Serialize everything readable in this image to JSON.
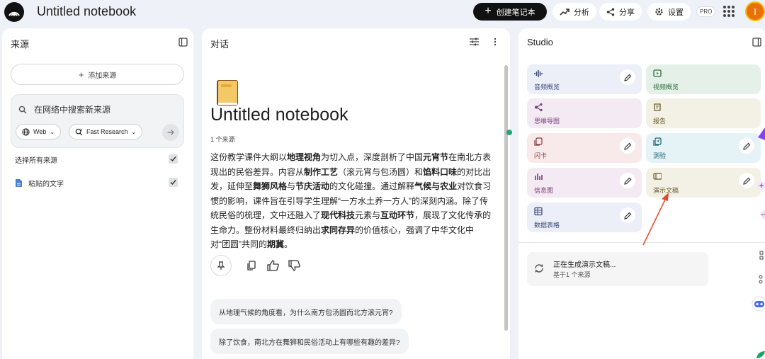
{
  "app": {
    "notebook_title": "Untitled notebook",
    "create_button": "创建笔记本",
    "analytics_button": "分析",
    "share_button": "分享",
    "settings_button": "设置",
    "pro_badge": "PRO",
    "avatar_letter": "I"
  },
  "sources": {
    "header": "来源",
    "add_button": "添加来源",
    "search_placeholder": "在网络中搜索新来源",
    "web_chip": "Web",
    "research_chip": "Fast Research",
    "select_all": "选择所有来源",
    "items": [
      {
        "label": "粘贴的文字",
        "checked": true
      }
    ]
  },
  "chat": {
    "header": "对话",
    "title": "Untitled notebook",
    "source_count": "1 个来源",
    "summary": [
      {
        "t": "这份教学课件大纲以"
      },
      {
        "t": "地理视角",
        "b": true
      },
      {
        "t": "为切入点，深度剖析了中国"
      },
      {
        "t": "元宵节",
        "b": true
      },
      {
        "t": "在南北方表现出的民俗差异。内容从"
      },
      {
        "t": "制作工艺",
        "b": true
      },
      {
        "t": "（滚元宵与包汤圆）和"
      },
      {
        "t": "馅料口味",
        "b": true
      },
      {
        "t": "的对比出发，延伸至"
      },
      {
        "t": "舞狮风格",
        "b": true
      },
      {
        "t": "与"
      },
      {
        "t": "节庆活动",
        "b": true
      },
      {
        "t": "的文化碰撞。通过解释"
      },
      {
        "t": "气候与农业",
        "b": true
      },
      {
        "t": "对饮食习惯的影响，课件旨在引导学生理解“一方水土养一方人”的深刻内涵。除了传统民俗的梳理，文中还融入了"
      },
      {
        "t": "现代科技",
        "b": true
      },
      {
        "t": "元素与"
      },
      {
        "t": "互动环节",
        "b": true
      },
      {
        "t": "，展现了文化传承的生命力。整份材料最终归纳出"
      },
      {
        "t": "求同存异",
        "b": true
      },
      {
        "t": "的价值核心，强调了中华文化中对“团圆”共同的"
      },
      {
        "t": "期冀",
        "b": true
      },
      {
        "t": "。"
      }
    ],
    "suggestions": [
      "从地理气候的角度看，为什么南方包汤圆而北方滚元宵?",
      "除了饮食，南北方在舞狮和民俗活动上有哪些有趣的差异?"
    ]
  },
  "studio": {
    "header": "Studio",
    "cards": [
      {
        "label": "音频概览",
        "bg": "#eceef8",
        "fg": "#3c4a7a",
        "icon": "audio-wave-icon",
        "edit": true
      },
      {
        "label": "视频概览",
        "bg": "#e5f1e8",
        "fg": "#2e6b3e",
        "icon": "video-icon",
        "edit": false
      },
      {
        "label": "思维导图",
        "bg": "#f3eaf3",
        "fg": "#7a3c78",
        "icon": "mind-map-icon",
        "edit": false
      },
      {
        "label": "报告",
        "bg": "#f3f1e6",
        "fg": "#6b5a2a",
        "icon": "report-icon",
        "edit": false
      },
      {
        "label": "闪卡",
        "bg": "#f8eaea",
        "fg": "#8a3b3b",
        "icon": "flashcard-icon",
        "edit": true
      },
      {
        "label": "测验",
        "bg": "#e5f2f6",
        "fg": "#1f6272",
        "icon": "quiz-icon",
        "edit": true
      },
      {
        "label": "信息图",
        "bg": "#f3eaf3",
        "fg": "#7a3c78",
        "icon": "infographic-icon",
        "edit": true
      },
      {
        "label": "演示文稿",
        "bg": "#f3f1e6",
        "fg": "#6b5a2a",
        "icon": "slides-icon",
        "edit": true
      },
      {
        "label": "数据表格",
        "bg": "#eceef8",
        "fg": "#3c4a7a",
        "icon": "table-icon",
        "edit": true
      }
    ],
    "generating_title": "正在生成演示文稿...",
    "generating_sub": "基于1 个来源"
  }
}
